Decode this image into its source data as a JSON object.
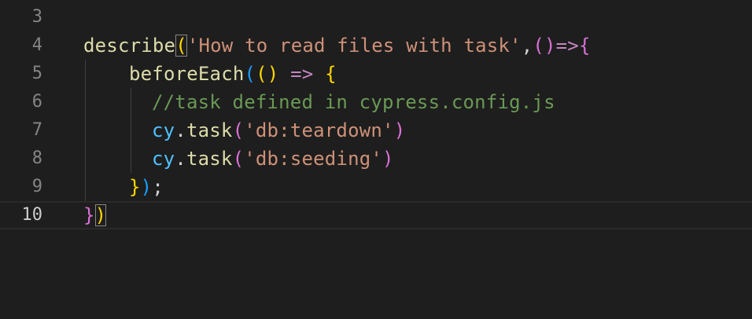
{
  "editor": {
    "lines": [
      {
        "number": "3",
        "text": ""
      },
      {
        "number": "4",
        "tokens": {
          "fn": "describe",
          "open": "(",
          "str": "'How to read files with task'",
          "comma": ",",
          "params": "()",
          "arrow": "=>",
          "brace": "{"
        }
      },
      {
        "number": "5",
        "tokens": {
          "fn": "beforeEach",
          "open": "(",
          "params": "()",
          "arrow": " => ",
          "brace": "{"
        }
      },
      {
        "number": "6",
        "tokens": {
          "comment": "//task defined in cypress.config.js"
        }
      },
      {
        "number": "7",
        "tokens": {
          "obj": "cy",
          "dot": ".",
          "fn": "task",
          "open": "(",
          "str": "'db:teardown'",
          "close": ")"
        }
      },
      {
        "number": "8",
        "tokens": {
          "obj": "cy",
          "dot": ".",
          "fn": "task",
          "open": "(",
          "str": "'db:seeding'",
          "close": ")"
        }
      },
      {
        "number": "9",
        "tokens": {
          "brace": "}",
          "close": ")",
          "semi": ";"
        }
      },
      {
        "number": "10",
        "tokens": {
          "brace": "}",
          "close": ")"
        }
      }
    ]
  },
  "theme": {
    "background": "#1e1e1e",
    "function": "#dcdcaa",
    "string": "#ce9178",
    "comment": "#6a9955",
    "variable": "#4fc1ff",
    "keyword": "#c586c0",
    "bracket_level1": "#ffd700",
    "bracket_level2": "#da70d6",
    "bracket_level3": "#179fff"
  }
}
